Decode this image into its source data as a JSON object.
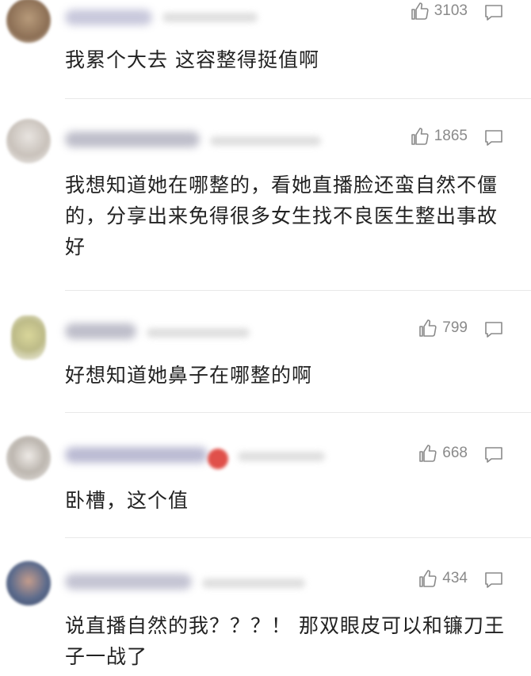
{
  "comments": [
    {
      "likes": "3103",
      "text": "我累个大去 这容整得挺值啊"
    },
    {
      "likes": "1865",
      "text": "我想知道她在哪整的，看她直播脸还蛮自然不僵的，分享出来免得很多女生找不良医生整出事故好"
    },
    {
      "likes": "799",
      "text": "好想知道她鼻子在哪整的啊"
    },
    {
      "likes": "668",
      "text": "卧槽，这个值"
    },
    {
      "likes": "434",
      "text": "说直播自然的我？？？！ 那双眼皮可以和镰刀王子一战了"
    }
  ],
  "icons": {
    "like": "thumbs-up-icon",
    "reply": "comment-icon"
  },
  "colors": {
    "text": "#222222",
    "meta": "#8a8a8a",
    "divider": "#e8e8e8"
  }
}
